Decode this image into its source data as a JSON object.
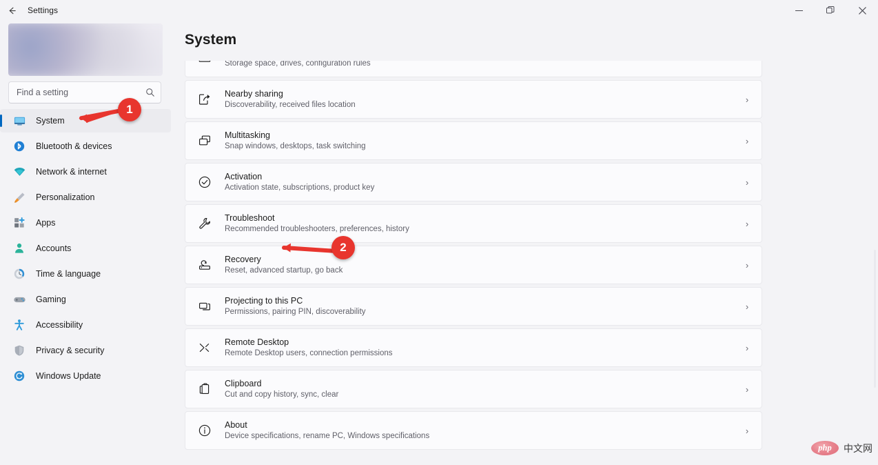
{
  "window": {
    "titlebar_title": "Settings",
    "back_icon": "arrow-left-icon",
    "controls": [
      {
        "name": "minimize-button",
        "glyph": "minimize-icon"
      },
      {
        "name": "restore-button",
        "glyph": "restore-icon"
      },
      {
        "name": "close-button",
        "glyph": "close-icon"
      }
    ]
  },
  "sidebar": {
    "profile": {
      "label": "",
      "blurred": true
    },
    "search": {
      "placeholder": "Find a setting",
      "value": "",
      "icon": "search-icon"
    },
    "items": [
      {
        "label": "System",
        "icon": "monitor-icon",
        "selected": true
      },
      {
        "label": "Bluetooth & devices",
        "icon": "bluetooth-icon",
        "selected": false
      },
      {
        "label": "Network & internet",
        "icon": "wifi-icon",
        "selected": false
      },
      {
        "label": "Personalization",
        "icon": "paintbrush-icon",
        "selected": false
      },
      {
        "label": "Apps",
        "icon": "apps-grid-icon",
        "selected": false
      },
      {
        "label": "Accounts",
        "icon": "person-icon",
        "selected": false
      },
      {
        "label": "Time & language",
        "icon": "clock-icon",
        "selected": false
      },
      {
        "label": "Gaming",
        "icon": "gamepad-icon",
        "selected": false
      },
      {
        "label": "Accessibility",
        "icon": "accessibility-icon",
        "selected": false
      },
      {
        "label": "Privacy & security",
        "icon": "shield-icon",
        "selected": false
      },
      {
        "label": "Windows Update",
        "icon": "update-refresh-icon",
        "selected": false
      }
    ]
  },
  "main": {
    "page_title": "System",
    "clipped_row": {
      "sub": "Storage space, drives, configuration rules"
    },
    "rows": [
      {
        "title": "Nearby sharing",
        "sub": "Discoverability, received files location",
        "icon": "share-export-icon",
        "chevron": "›"
      },
      {
        "title": "Multitasking",
        "sub": "Snap windows, desktops, task switching",
        "icon": "multitasking-windows-icon",
        "chevron": "›"
      },
      {
        "title": "Activation",
        "sub": "Activation state, subscriptions, product key",
        "icon": "check-circle-icon",
        "chevron": "›"
      },
      {
        "title": "Troubleshoot",
        "sub": "Recommended troubleshooters, preferences, history",
        "icon": "wrench-icon",
        "chevron": "›"
      },
      {
        "title": "Recovery",
        "sub": "Reset, advanced startup, go back",
        "icon": "recovery-drive-icon",
        "chevron": "›"
      },
      {
        "title": "Projecting to this PC",
        "sub": "Permissions, pairing PIN, discoverability",
        "icon": "project-screen-icon",
        "chevron": "›"
      },
      {
        "title": "Remote Desktop",
        "sub": "Remote Desktop users, connection permissions",
        "icon": "remote-desktop-icon",
        "chevron": "›"
      },
      {
        "title": "Clipboard",
        "sub": "Cut and copy history, sync, clear",
        "icon": "clipboard-icon",
        "chevron": "›"
      },
      {
        "title": "About",
        "sub": "Device specifications, rename PC, Windows specifications",
        "icon": "info-circle-icon",
        "chevron": "›"
      }
    ]
  },
  "annotations": {
    "accent_color": "#e8352e",
    "markers": [
      {
        "number": "1",
        "points_to": "sidebar-item-system"
      },
      {
        "number": "2",
        "points_to": "settings-row-recovery"
      }
    ]
  },
  "watermark": {
    "logo_text": "php",
    "site_text": "中文网",
    "logo_color": "#de6c7a"
  }
}
